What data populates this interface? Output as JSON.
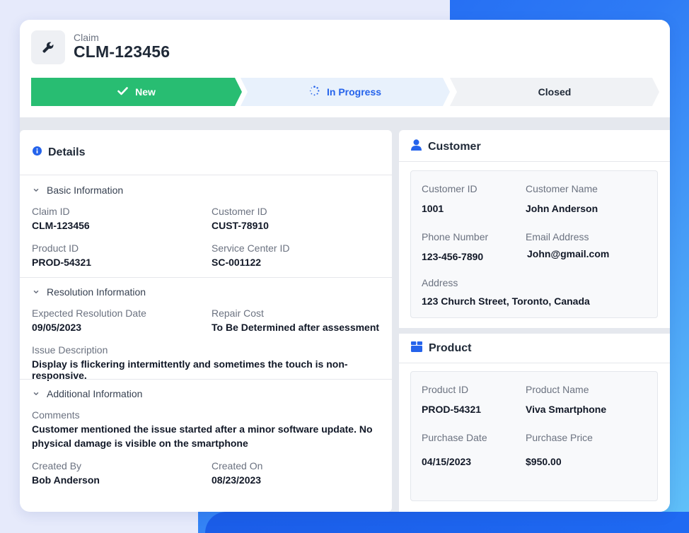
{
  "colors": {
    "accent": "#2563eb",
    "success": "#28bd72",
    "progress_bg": "#e8f1fc",
    "closed_bg": "#f0f2f5"
  },
  "claim": {
    "label": "Claim",
    "id": "CLM-123456"
  },
  "stages": [
    {
      "label": "New",
      "state": "done",
      "icon": "check-icon"
    },
    {
      "label": "In Progress",
      "state": "current",
      "icon": "spinner-icon"
    },
    {
      "label": "Closed",
      "state": "pending",
      "icon": ""
    }
  ],
  "details": {
    "title": "Details",
    "basic": {
      "title": "Basic Information",
      "claim_id_label": "Claim ID",
      "claim_id": "CLM-123456",
      "customer_id_label": "Customer ID",
      "customer_id": "CUST-78910",
      "product_id_label": "Product ID",
      "product_id": "PROD-54321",
      "service_center_label": "Service Center ID",
      "service_center": "SC-001122"
    },
    "resolution": {
      "title": "Resolution Information",
      "date_label": "Expected Resolution Date",
      "date": "09/05/2023",
      "cost_label": "Repair Cost",
      "cost": "To Be Determined after assessment",
      "issue_label": "Issue Description",
      "issue": "Display is flickering intermittently and sometimes the touch is non-responsive."
    },
    "additional": {
      "title": "Additional Information",
      "comments_label": "Comments",
      "comments_line1": "Customer mentioned the issue started after a minor software update. No",
      "comments_line2": "physical damage is visible on the smartphone",
      "created_by_label": "Created By",
      "created_by": "Bob Anderson",
      "created_on_label": "Created On",
      "created_on": "08/23/2023"
    }
  },
  "customer": {
    "title": "Customer",
    "id_label": "Customer ID",
    "id": "1001",
    "name_label": "Customer Name",
    "name": "John Anderson",
    "phone_label": "Phone Number",
    "phone": "123-456-7890",
    "email_label": "Email Address",
    "email": "John@gmail.com",
    "address_label": "Address",
    "address": "123 Church Street, Toronto, Canada"
  },
  "product": {
    "title": "Product",
    "id_label": "Product ID",
    "id": "PROD-54321",
    "name_label": "Product Name",
    "name": "Viva Smartphone",
    "date_label": "Purchase Date",
    "date": "04/15/2023",
    "price_label": "Purchase Price",
    "price": "$950.00"
  }
}
